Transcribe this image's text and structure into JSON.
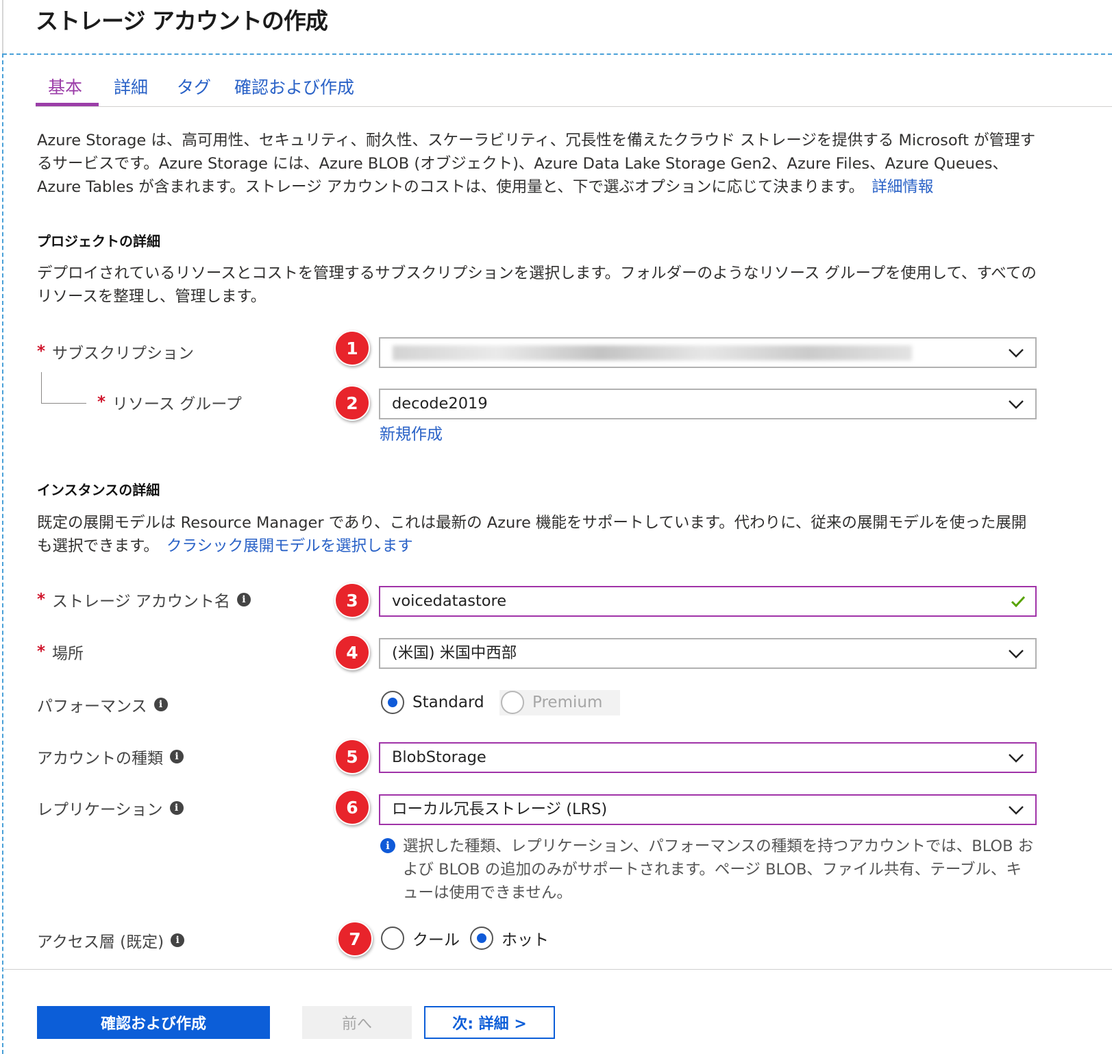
{
  "page": {
    "title": "ストレージ アカウントの作成"
  },
  "tabs": [
    {
      "label": "基本"
    },
    {
      "label": "詳細"
    },
    {
      "label": "タグ"
    },
    {
      "label": "確認および作成"
    }
  ],
  "intro": {
    "text": "Azure Storage は、高可用性、セキュリティ、耐久性、スケーラビリティ、冗長性を備えたクラウド ストレージを提供する Microsoft が管理するサービスです。Azure Storage には、Azure BLOB (オブジェクト)、Azure Data Lake Storage Gen2、Azure Files、Azure Queues、Azure Tables が含まれます。ストレージ アカウントのコストは、使用量と、下で選ぶオプションに応じて決まります。",
    "link": "詳細情報"
  },
  "project": {
    "title": "プロジェクトの詳細",
    "description": "デプロイされているリソースとコストを管理するサブスクリプションを選択します。フォルダーのようなリソース グループを使用して、すべてのリソースを整理し、管理します。",
    "subscription_label": "サブスクリプション",
    "resource_group_label": "リソース グループ",
    "resource_group_value": "decode2019",
    "create_new_link": "新規作成"
  },
  "instance": {
    "title": "インスタンスの詳細",
    "description": "既定の展開モデルは Resource Manager であり、これは最新の Azure 機能をサポートしています。代わりに、従来の展開モデルを使った展開も選択できます。",
    "classic_link": "クラシック展開モデルを選択します",
    "account_name_label": "ストレージ アカウント名",
    "account_name_value": "voicedatastore",
    "location_label": "場所",
    "location_value": "(米国) 米国中西部",
    "performance_label": "パフォーマンス",
    "performance_options": [
      "Standard",
      "Premium"
    ],
    "performance_selected": "Standard",
    "account_kind_label": "アカウントの種類",
    "account_kind_value": "BlobStorage",
    "replication_label": "レプリケーション",
    "replication_value": "ローカル冗長ストレージ (LRS)",
    "replication_notice": "選択した種類、レプリケーション、パフォーマンスの種類を持つアカウントでは、BLOB および BLOB の追加のみがサポートされます。ページ BLOB、ファイル共有、テーブル、キューは使用できません。",
    "access_tier_label": "アクセス層 (既定)",
    "access_tier_options": [
      "クール",
      "ホット"
    ],
    "access_tier_selected": "ホット"
  },
  "badges": [
    "1",
    "2",
    "3",
    "4",
    "5",
    "6",
    "7"
  ],
  "footer": {
    "review_create": "確認および作成",
    "previous": "前へ",
    "next": "次: 詳細 >"
  },
  "colors": {
    "accent_purple": "#9b3da8",
    "primary_blue": "#0c5ed8",
    "required_red": "#d0172d",
    "badge_red": "#e8242b",
    "valid_green": "#57a300"
  },
  "icons": [
    "info-icon",
    "chevron-down-icon",
    "checkmark-icon"
  ]
}
